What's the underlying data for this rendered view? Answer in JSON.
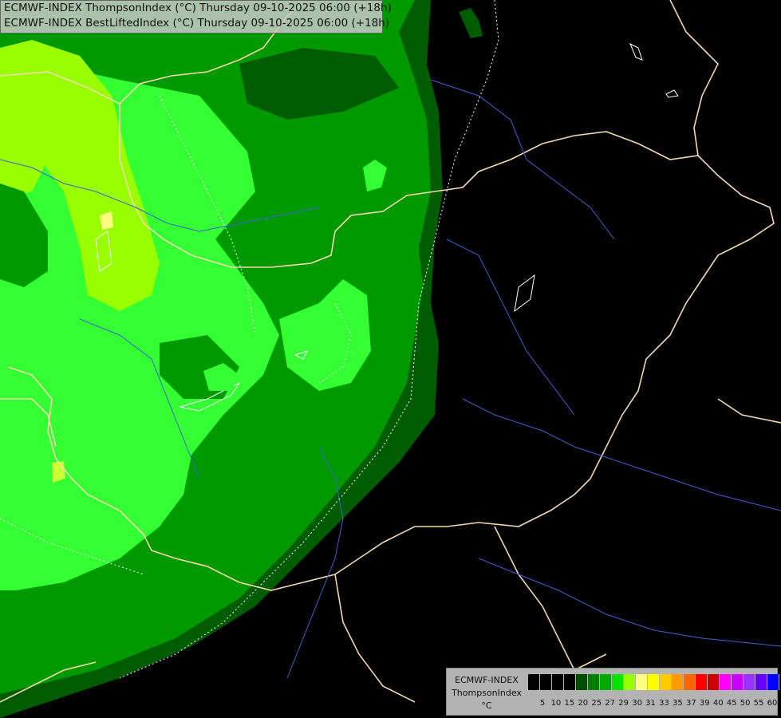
{
  "titles": {
    "line1": "ECMWF-INDEX ThompsonIndex (°C) Thursday 09-10-2025 06:00 (+18h)",
    "line2": "ECMWF-INDEX BestLiftedIndex (°C) Thursday 09-10-2025 06:00 (+18h)"
  },
  "legend": {
    "model": "ECMWF-INDEX",
    "parameter": "ThompsonIndex",
    "unit": "°C",
    "swatch_colors": [
      "#000000",
      "#000000",
      "#000000",
      "#000000",
      "#004d00",
      "#008000",
      "#00aa00",
      "#00e600",
      "#99ff00",
      "#ffff80",
      "#ffff00",
      "#ffcc00",
      "#ff9900",
      "#ff6600",
      "#ff0000",
      "#cc0000",
      "#ff00ff",
      "#cc00ff",
      "#9933ff",
      "#6600ff",
      "#0000ff"
    ],
    "ticks": [
      "5",
      "10",
      "15",
      "20",
      "25",
      "27",
      "29",
      "30",
      "31",
      "33",
      "35",
      "37",
      "39",
      "40",
      "45",
      "50",
      "55",
      "60"
    ]
  },
  "colors": {
    "background": "#000000",
    "level_20_25": "#005c00",
    "level_25_27": "#009900",
    "level_27_29": "#00cc00",
    "level_29_30": "#33ff33",
    "level_30_31": "#99ff00",
    "level_31_33": "#ccff33",
    "level_33_35": "#ffff80",
    "borders": "#f5d7b0",
    "rivers": "#4060d0",
    "lifted_index_contour": "#ffffff"
  }
}
